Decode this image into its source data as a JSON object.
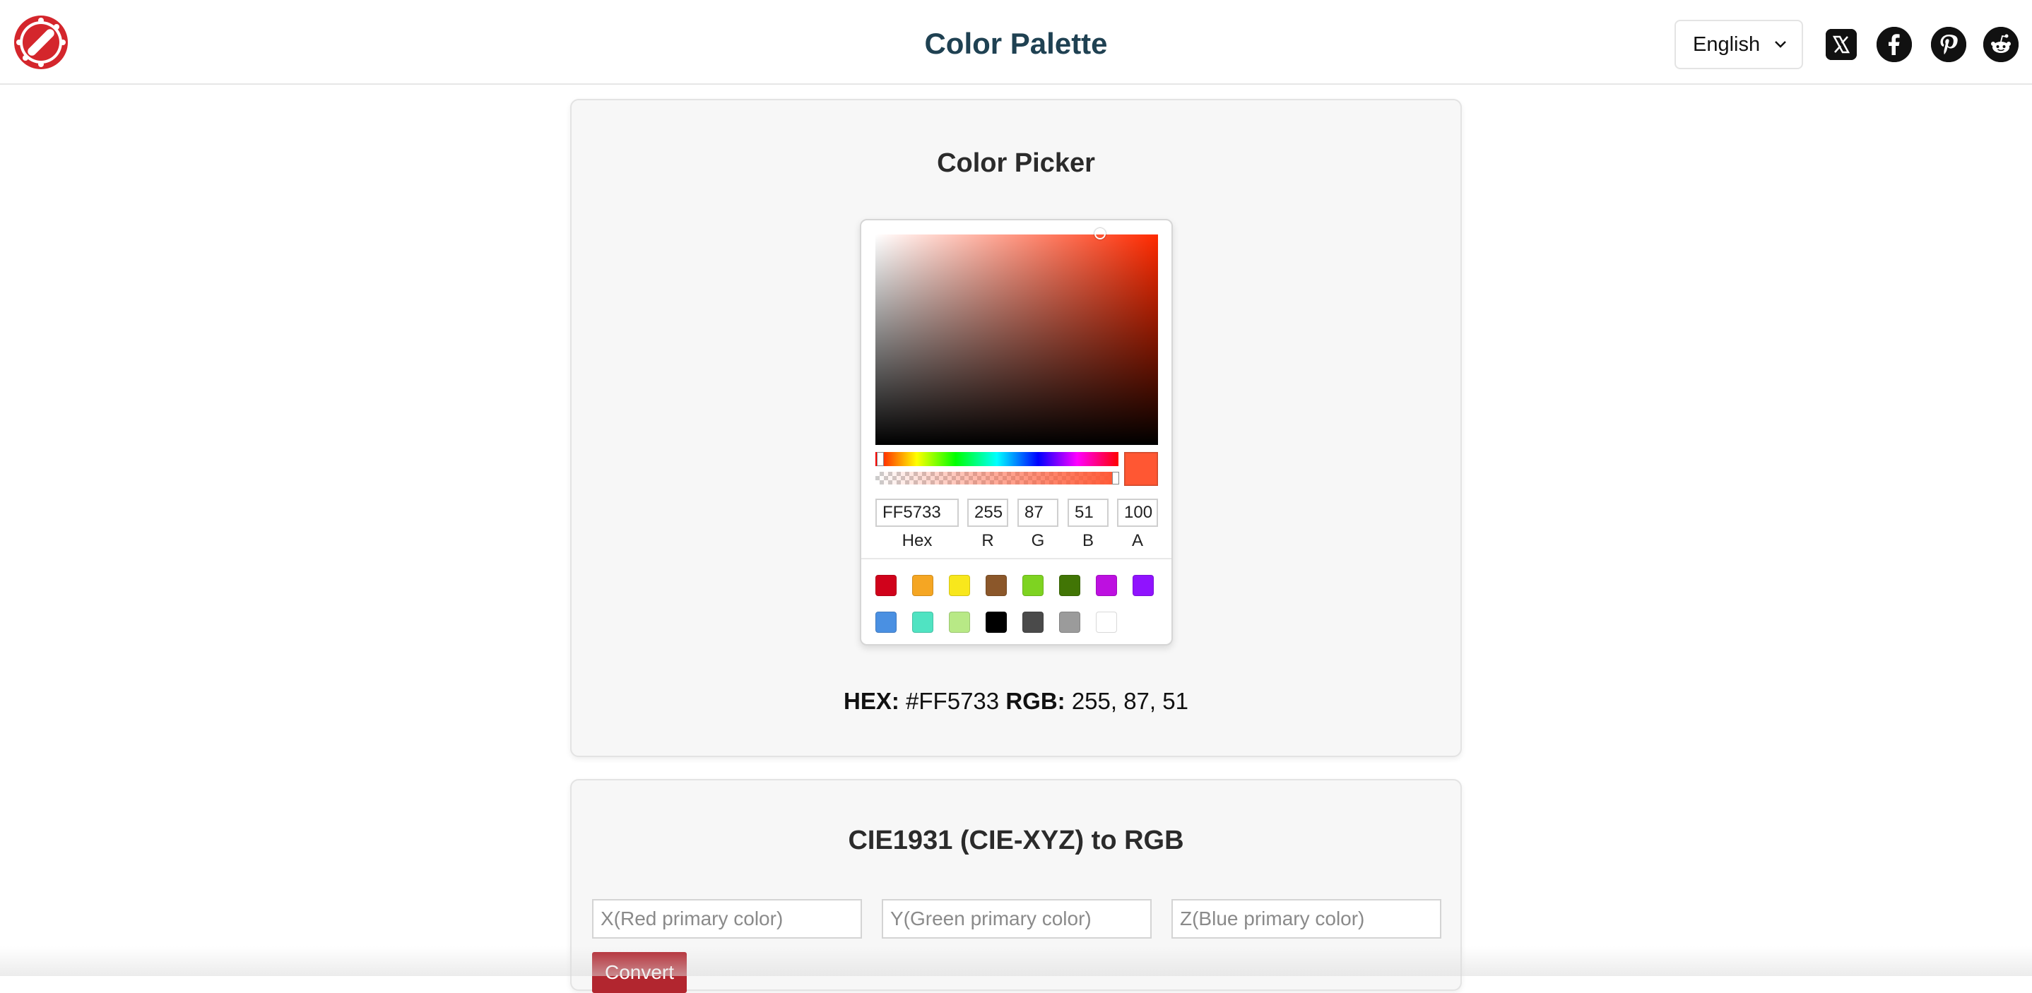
{
  "header": {
    "title": "Color Palette",
    "language": "English",
    "logo_icon": "palette-logo-icon",
    "social": [
      "x-icon",
      "facebook-icon",
      "pinterest-icon",
      "reddit-icon"
    ]
  },
  "color_picker": {
    "title": "Color Picker",
    "hex_value": "FF5733",
    "r_value": "255",
    "g_value": "87",
    "b_value": "51",
    "a_value": "100",
    "labels": {
      "hex": "Hex",
      "r": "R",
      "g": "G",
      "b": "B",
      "a": "A"
    },
    "current_color": "#FF5733",
    "hue_color": "#FF2A00",
    "alpha_percent": 100,
    "swatches": [
      "#D0021B",
      "#F5A623",
      "#F8E71C",
      "#8B572A",
      "#7ED321",
      "#417505",
      "#BD10E0",
      "#9013FE",
      "#4A90E2",
      "#50E3C2",
      "#B8E986",
      "#000000",
      "#4A4A4A",
      "#9B9B9B",
      "#FFFFFF"
    ]
  },
  "readout": {
    "hex_label": "HEX:",
    "hex_value": "#FF5733",
    "rgb_label": "RGB:",
    "rgb_value": "255, 87, 51"
  },
  "xyz_converter": {
    "title": "CIE1931 (CIE-XYZ) to RGB",
    "x_placeholder": "X(Red primary color)",
    "y_placeholder": "Y(Green primary color)",
    "z_placeholder": "Z(Blue primary color)",
    "button_label": "Convert",
    "button_color": "#B2262F"
  }
}
